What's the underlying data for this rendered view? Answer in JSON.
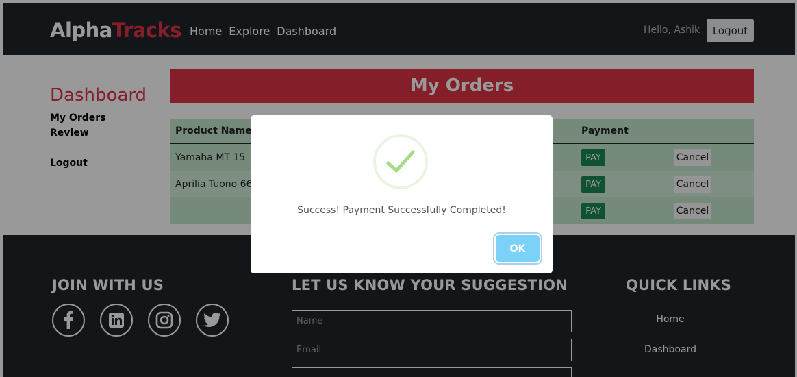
{
  "brand": {
    "part1": "Alpha",
    "part2": "Tracks"
  },
  "nav": {
    "links": [
      "Home",
      "Explore",
      "Dashboard"
    ],
    "greeting": "Hello, Ashik",
    "logout": "Logout"
  },
  "sidebar": {
    "title": "Dashboard",
    "items": [
      "My Orders",
      "Review",
      "Logout"
    ]
  },
  "orders": {
    "title": "My Orders",
    "headers": {
      "product": "Product Name",
      "payment": "Payment"
    },
    "rows": [
      {
        "product": "Yamaha MT 15",
        "pay": "PAY",
        "cancel": "Cancel"
      },
      {
        "product": "Aprilia Tuono 660",
        "pay": "PAY",
        "cancel": "Cancel"
      },
      {
        "product": "",
        "pay": "PAY",
        "cancel": "Cancel"
      }
    ]
  },
  "footer": {
    "join_title": "JOIN WITH US",
    "social": [
      "facebook-icon",
      "linkedin-icon",
      "instagram-icon",
      "twitter-icon"
    ],
    "suggest_title": "LET US KNOW YOUR SUGGESTION",
    "name_placeholder": "Name",
    "email_placeholder": "Email",
    "quick_title": "QUICK LINKS",
    "quick_links": [
      "Home",
      "Dashboard"
    ]
  },
  "modal": {
    "message": "Success! Payment Successfully Completed!",
    "ok": "OK"
  },
  "colors": {
    "accent": "#dc3545",
    "dark": "#212529",
    "success_icon": "#a5dc86",
    "ok_button": "#7cd1f9",
    "pay_button": "#198754"
  }
}
